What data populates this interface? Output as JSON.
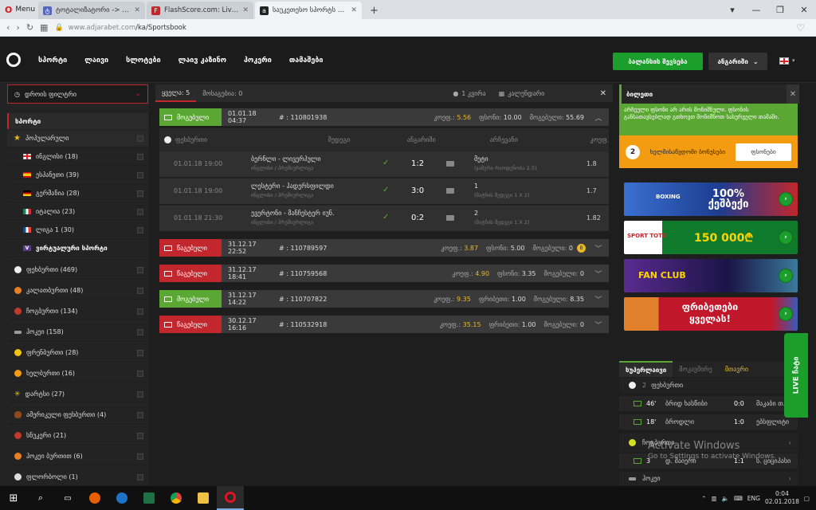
{
  "browser": {
    "menu_label": "Menu",
    "tabs": [
      {
        "title": "ტოტალიზატორი -> თამ",
        "icon": "tote-icon",
        "color": "#5566bb"
      },
      {
        "title": "FlashScore.com: Live Socce",
        "icon": "flashscore-icon",
        "color": "#c1272d"
      },
      {
        "title": "საუკეთესო სპორტს ბეტ",
        "icon": "adjarabet-icon",
        "color": "#222222"
      }
    ],
    "new_tab": "+",
    "url_host": "www.adjarabet.com",
    "url_path": "/ka/Sportsbook"
  },
  "site": {
    "nav": [
      "სპორტი",
      "ლაივი",
      "სლოტები",
      "ლაივ კაზინო",
      "პოკერი",
      "თამაშები"
    ],
    "deposit_label": "ბალანსის შევსება",
    "account_label": "ანგარიში",
    "colors": {
      "accent_green": "#1b9e2c",
      "accent_red": "#c1272d",
      "accent_yellow": "#e8b923",
      "orange": "#f39c12"
    }
  },
  "sidebar": {
    "time_filter": "დროის ფილტრი",
    "sports_header": "სპორტი",
    "popular": {
      "label": "პოპულარული",
      "items": [
        {
          "label": "ინგლისი (18)",
          "flag": "england"
        },
        {
          "label": "ესპანეთი (39)",
          "flag": "spain"
        },
        {
          "label": "გერმანია (28)",
          "flag": "germany"
        },
        {
          "label": "იტალია (23)",
          "flag": "italy"
        },
        {
          "label": "ლიგა 1 (30)",
          "flag": "france"
        },
        {
          "label": "ვირტუალური სპორტი",
          "flag": "virtual"
        }
      ]
    },
    "sports": [
      {
        "label": "ფეხბურთი (469)",
        "color": "#eeeeee"
      },
      {
        "label": "კალათბურთი (48)",
        "color": "#e67e22"
      },
      {
        "label": "ჩოგბურთი (134)",
        "color": "#c0392b"
      },
      {
        "label": "ჰოკეი (158)",
        "color": "#999999"
      },
      {
        "label": "ფრენბურთი (28)",
        "color": "#f1c40f"
      },
      {
        "label": "ხელბურთი (16)",
        "color": "#f39c12"
      },
      {
        "label": "დარტსი (27)",
        "color": "#f1c40f"
      },
      {
        "label": "ამერიკული ფეხბურთი (4)",
        "color": "#8e4a1f"
      },
      {
        "label": "სნუკერი (21)",
        "color": "#c0392b"
      },
      {
        "label": "ჰოკეი ბურთით (6)",
        "color": "#e67e22"
      },
      {
        "label": "ფლორბოლი (1)",
        "color": "#dddddd"
      }
    ]
  },
  "center": {
    "topbar": {
      "all": "ყველა: 5",
      "pending": "მოსაგებია: 0",
      "coupon": "1 კვირა",
      "calendar": "კალენდარი"
    },
    "events": [
      {
        "status": "მოგებული",
        "status_type": "win",
        "date": "01.01.18 04:37",
        "num": "# : 110801938",
        "k_label": "კოეფ.:",
        "k": "5.56",
        "stake_label": "ფსონი:",
        "stake": "10.00",
        "win_label": "მოგებული:",
        "win": "55.69",
        "expanded": true
      },
      {
        "status": "წაგებული",
        "status_type": "lose",
        "date": "31.12.17 22:52",
        "num": "# : 110789597",
        "k_label": "კოეფ.:",
        "k": "3.87",
        "stake_label": "ფსონი:",
        "stake": "5.00",
        "win_label": "მოგებული:",
        "win": "0"
      },
      {
        "status": "წაგებული",
        "status_type": "lose",
        "date": "31.12.17 18:41",
        "num": "# : 110759568",
        "k_label": "კოეფ.:",
        "k": "4.90",
        "stake_label": "ფსონი:",
        "stake": "3.35",
        "win_label": "მოგებული:",
        "win": "0"
      },
      {
        "status": "მოგებული",
        "status_type": "win",
        "date": "31.12.17 14:22",
        "num": "# : 110707822",
        "k_label": "კოეფ.:",
        "k": "9.35",
        "stake_label": "ფრიბეთი:",
        "stake": "1.00",
        "win_label": "მოგებული:",
        "win": "8.35"
      },
      {
        "status": "წაგებული",
        "status_type": "lose",
        "date": "30.12.17 16:16",
        "num": "# : 110532918",
        "k_label": "კოეფ.:",
        "k": "35.15",
        "stake_label": "ფრიბეთი:",
        "stake": "1.00",
        "win_label": "მოგებული:",
        "win": "0"
      }
    ],
    "columns": [
      "ფეხბურთი",
      "შედეგი",
      "ანგარიში",
      "არჩევანი",
      "კოეფ."
    ],
    "matches": [
      {
        "time": "01.01.18 19:00",
        "teams": "ბერნლი - ლივერპული",
        "league": "ინგლისი / პრემიერლიგა",
        "score": "1:2",
        "sel": "მეტი",
        "sel_desc": "(ჯამური რაოდენობა 2.5)",
        "odd": "1.8"
      },
      {
        "time": "01.01.18 19:00",
        "teams": "ლესტერი - ჰადერსფილდი",
        "league": "ინგლისი / პრემიერლიგა",
        "score": "3:0",
        "sel": "1",
        "sel_desc": "(მატჩის შედეგი 1 X 2)",
        "odd": "1.7"
      },
      {
        "time": "01.01.18 21:30",
        "teams": "ევერტონი - მანჩესტერ იუნ.",
        "league": "ინგლისი / პრემიერლიგა",
        "score": "0:2",
        "sel": "2",
        "sel_desc": "(მატჩის შედეგი 1 X 2)",
        "odd": "1.82"
      }
    ]
  },
  "right": {
    "betslip_title": "ბილეთი",
    "betslip_msg": "არჩეული ფსონი არ არის მონიშნული. ფსონის განსათავსებლად გთხოვთ მონიშნოთ სასურველი თამაში.",
    "bonus_count": "2",
    "bonus_text": "ხელმისაწვდომი ბონუსები",
    "bonus_btn": "ფსონები",
    "banners": [
      {
        "text": "100% ქეშბექი",
        "tag": "BOXING",
        "bg": "#1d3d8f"
      },
      {
        "text": "150 000₾",
        "tag": "SPORT TOTO",
        "bg": "#0f7a2b"
      },
      {
        "text": "FAN CLUB",
        "tag": "",
        "bg": "#3a1b6e"
      },
      {
        "text": "ფრიბეთები ყველას!",
        "tag": "",
        "bg": "#b8172a"
      }
    ],
    "tabs": [
      "სუპერლაივი",
      "მოკავშირე",
      "მთავრი"
    ],
    "live_rows": [
      {
        "type": "sport",
        "label": "ფეხბურთი",
        "num": "2"
      },
      {
        "type": "match",
        "time": "46'",
        "home": "ბრიდ ხასწიბი",
        "score": "0:0",
        "away": "მაკაბი თ.ა."
      },
      {
        "type": "match",
        "time": "18'",
        "home": "ბროდლი",
        "score": "1:0",
        "away": "ებსფლიტი"
      },
      {
        "type": "sport",
        "label": "ჩოგბურთი",
        "num": ""
      },
      {
        "type": "match",
        "time": "3",
        "home": "დ. მაიერი",
        "score": "1:1",
        "away": "ს. ციციპასი"
      },
      {
        "type": "sport",
        "label": "ჰოკეი",
        "num": ""
      }
    ],
    "live_button": "LIVE ჩატი"
  },
  "os": {
    "activate_title": "Activate Windows",
    "activate_sub": "Go to Settings to activate Windows.",
    "lang": "ENG",
    "time": "0:04",
    "date": "02.01.2018"
  }
}
